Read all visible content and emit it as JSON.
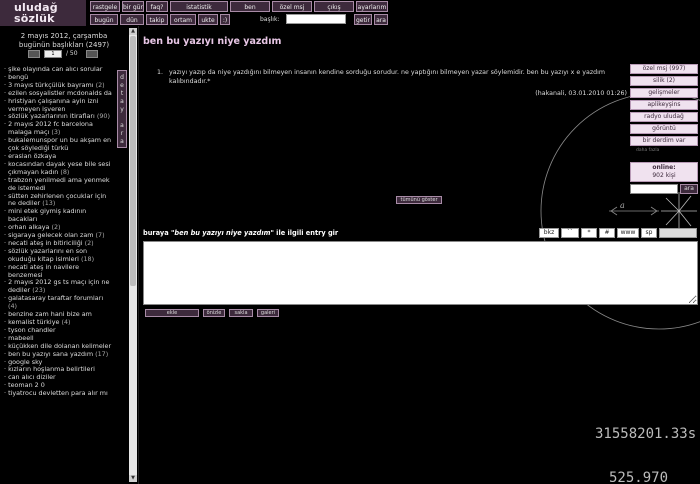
{
  "logo": {
    "line1": "uludağ",
    "line2": "sözlük"
  },
  "top_nav": {
    "row1": [
      "rastgele",
      "bir gün",
      "faq?",
      "istatistik",
      "ben",
      "özel msj",
      "çıkış",
      "ayarlarım"
    ],
    "row2": [
      "bugün",
      "dün",
      "takip",
      "ortam",
      "ukte",
      ":)"
    ],
    "baslik_label": "başlık:",
    "getir": "getir",
    "ara": "ara"
  },
  "left": {
    "date_line1": "2 mayıs 2012, çarşamba",
    "date_line2": "bugünün başlıkları (2497)",
    "pager": {
      "page": "1",
      "total": "/ 50"
    },
    "detay_ara": [
      "d",
      "e",
      "t",
      "a",
      "y",
      "",
      "a",
      "r",
      "a"
    ],
    "topics": [
      {
        "title": "şike olayında can alıcı sorular",
        "count": ""
      },
      {
        "title": "bengü",
        "count": ""
      },
      {
        "title": "3 mayıs türkçülük bayramı",
        "count": "(2)"
      },
      {
        "title": "ezilen sosyalistler mcdonalds da",
        "count": ""
      },
      {
        "title": "hristiyan çalışanına ayin izni vermeyen işveren",
        "count": ""
      },
      {
        "title": "sözlük yazarlarının itirafları",
        "count": "(90)"
      },
      {
        "title": "2 mayıs 2012 fc barcelona malaga maçı",
        "count": "(3)"
      },
      {
        "title": "bukalemunspor un bu akşam en çok söylediği türkü",
        "count": ""
      },
      {
        "title": "eraslan özkaya",
        "count": ""
      },
      {
        "title": "kocasından dayak yese bile sesi çıkmayan kadın",
        "count": "(8)"
      },
      {
        "title": "trabzon yenilmedi ama yenmek de istemedi",
        "count": ""
      },
      {
        "title": "sütten zehirlenen çocuklar için ne dediler",
        "count": "(13)"
      },
      {
        "title": "mini etek giymiş kadının bacakları",
        "count": ""
      },
      {
        "title": "orhan alkaya",
        "count": "(2)"
      },
      {
        "title": "sigaraya gelecek olan zam",
        "count": "(7)"
      },
      {
        "title": "necati ateş in bitiriciliği",
        "count": "(2)"
      },
      {
        "title": "sözlük yazarlarını en son okuduğu kitap isimleri",
        "count": "(18)"
      },
      {
        "title": "necati ateş in navilere benzemesi",
        "count": ""
      },
      {
        "title": "2 mayıs 2012 gs ts maçı için ne dediler",
        "count": "(23)"
      },
      {
        "title": "galatasaray taraftar forumları",
        "count": "(4)"
      },
      {
        "title": "benzine zam hani bize am",
        "count": ""
      },
      {
        "title": "kemalist türkiye",
        "count": "(4)"
      },
      {
        "title": "tyson chandler",
        "count": ""
      },
      {
        "title": "mabeell",
        "count": ""
      },
      {
        "title": "küçükken dile dolanan kelimeler",
        "count": ""
      },
      {
        "title": "ben bu yazıyı sana yazdım",
        "count": "(17)"
      },
      {
        "title": "google sky",
        "count": ""
      },
      {
        "title": "kızların hoşlanma belirtileri",
        "count": ""
      },
      {
        "title": "can alıcı diziler",
        "count": ""
      },
      {
        "title": "teoman 2 0",
        "count": ""
      },
      {
        "title": "tiyatrocu devletten para alır mı",
        "count": ""
      }
    ]
  },
  "main": {
    "topic_title": "ben bu yazıyı niye yazdım",
    "entry_number": "1.",
    "entry_text": "yazıyı yazıp da niye yazdığını bilmeyen insanın kendine sorduğu sorudur. ne yaptığını bilmeyen yazar söylemidir. ben bu yazıyı x e yazdım kalıbındadır.*",
    "entry_meta": "(hakanali, 03.01.2010 01:26)",
    "show_all": "tümünü göster",
    "editor_prefix": "buraya ",
    "editor_topic": "\"ben bu yazıyı niye yazdım\"",
    "editor_suffix": " ile ilgili entry gir",
    "toolbar": [
      "bkz",
      "``",
      "*",
      "#",
      "www",
      "sp"
    ],
    "actions": [
      "ekle",
      "önizle",
      "sakla",
      "galeri"
    ]
  },
  "right": {
    "buttons": [
      "özel msj (997)",
      "silik (2)",
      "gelişmeler",
      "aplikeyşins",
      "radyo uludağ",
      "görüntü",
      "bir derdim var"
    ],
    "sub": "daha fazla",
    "online_label": "online:",
    "online_count": "902 kişi",
    "ara": "ara"
  },
  "decoration": {
    "num1": "31558201.33s",
    "num2": "525.970"
  },
  "colors": {
    "accent": "#3d2a3c",
    "title": "#e8c7e6",
    "panel": "#f0e2ef"
  }
}
